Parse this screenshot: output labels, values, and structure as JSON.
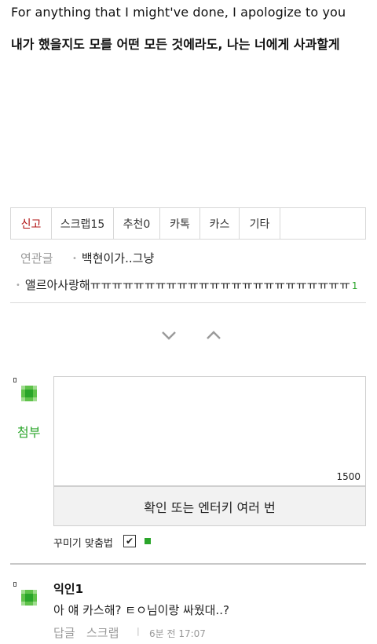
{
  "post": {
    "lyric_en": "For anything that I might've done, I apologize to you",
    "lyric_ko": "내가 했을지도 모를 어떤 모든 것에라도, 나는 너에게 사과할게"
  },
  "actions": {
    "report": "신고",
    "scrap": "스크랩15",
    "recommend": "추천0",
    "kakaotalk": "카톡",
    "kakaostory": "카스",
    "etc": "기타"
  },
  "related": {
    "label": "연관글",
    "items": [
      {
        "title": "백현이가..그냥",
        "count": ""
      },
      {
        "title": "앨르아사랑해ㅠㅠㅠㅠㅠㅠㅠㅠㅠㅠㅠㅠㅠㅠㅠㅠㅠㅠㅠㅠㅠㅠㅠㅠ",
        "count": "1"
      }
    ]
  },
  "comment_form": {
    "attach_label": "첨부",
    "char_limit": "1500",
    "submit_label": "확인 또는 엔터키 여러 번",
    "decorate_label": "꾸미기 맞춤법",
    "decorate_checked": true,
    "accent_color": "#2aa52a"
  },
  "comments": [
    {
      "author": "익인1",
      "text": "아 얘 카스해? ㅌㅇ님이랑 싸웠대..?",
      "reply_label": "답글",
      "scrap_label": "스크랩",
      "separator": "|",
      "time": "6분 전 17:07"
    }
  ]
}
